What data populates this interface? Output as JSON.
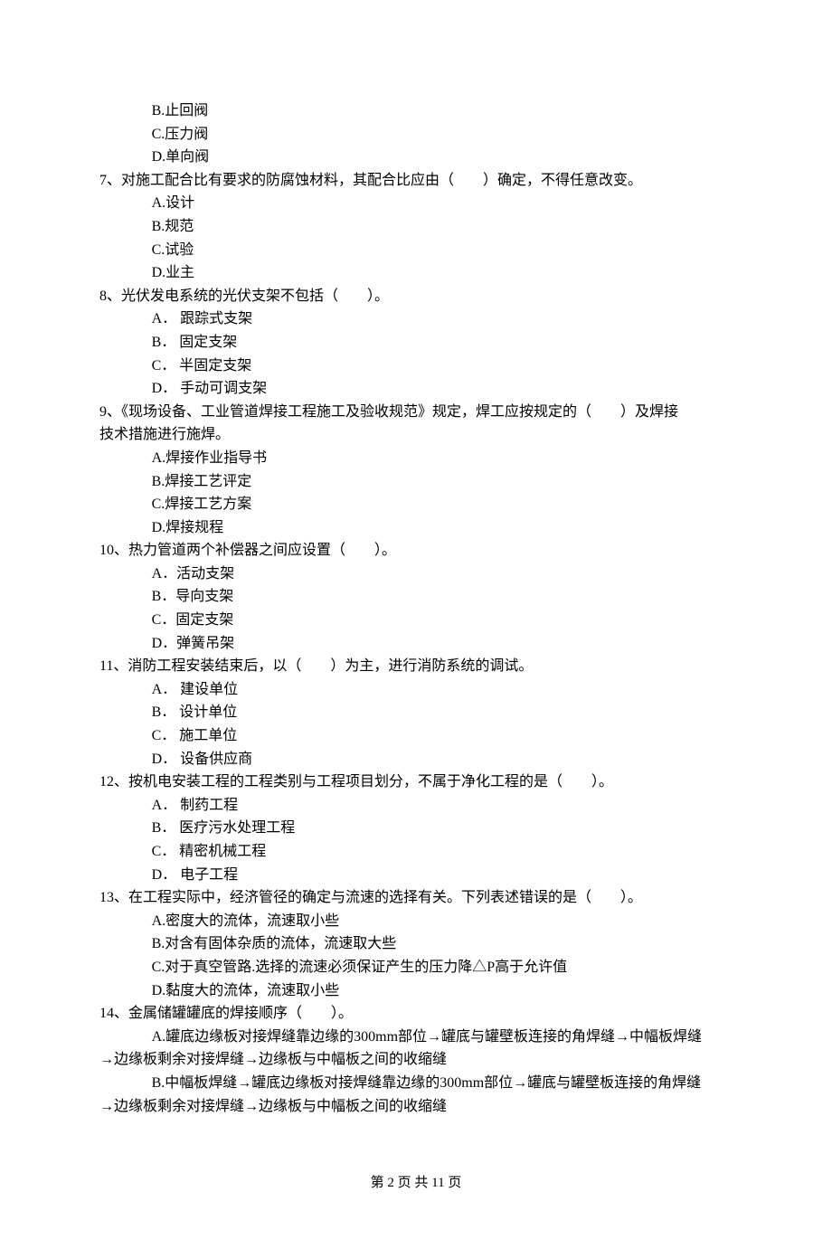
{
  "q6_options": {
    "B": "B.止回阀",
    "C": "C.压力阀",
    "D": "D.单向阀"
  },
  "q7": {
    "stem": "7、对施工配合比有要求的防腐蚀材料，其配合比应由（　　）确定，不得任意改变。",
    "A": "A.设计",
    "B": "B.规范",
    "C": "C.试验",
    "D": "D.业主"
  },
  "q8": {
    "stem": "8、光伏发电系统的光伏支架不包括（　　）。",
    "A": "A． 跟踪式支架",
    "B": "B． 固定支架",
    "C": "C． 半固定支架",
    "D": "D． 手动可调支架"
  },
  "q9": {
    "stem": "9、《现场设备、工业管道焊接工程施工及验收规范》规定，焊工应按规定的（　　）及焊接",
    "stem2": "技术措施进行施焊。",
    "A": "A.焊接作业指导书",
    "B": "B.焊接工艺评定",
    "C": "C.焊接工艺方案",
    "D": "D.焊接规程"
  },
  "q10": {
    "stem": "10、热力管道两个补偿器之间应设置（　　）。",
    "A": "A．活动支架",
    "B": "B．导向支架",
    "C": "C．固定支架",
    "D": "D．弹簧吊架"
  },
  "q11": {
    "stem": "11、消防工程安装结束后，以（　　）为主，进行消防系统的调试。",
    "A": "A． 建设单位",
    "B": "B． 设计单位",
    "C": "C． 施工单位",
    "D": "D． 设备供应商"
  },
  "q12": {
    "stem": "12、按机电安装工程的工程类别与工程项目划分，不属于净化工程的是（　　）。",
    "A": "A． 制药工程",
    "B": "B． 医疗污水处理工程",
    "C": "C． 精密机械工程",
    "D": "D． 电子工程"
  },
  "q13": {
    "stem": "13、在工程实际中，经济管径的确定与流速的选择有关。下列表述错误的是（　　）。",
    "A": "A.密度大的流体，流速取小些",
    "B": "B.对含有固体杂质的流体，流速取大些",
    "C": "C.对于真空管路.选择的流速必须保证产生的压力降△P高于允许值",
    "D": "D.黏度大的流体，流速取小些"
  },
  "q14": {
    "stem": "14、金属储罐罐底的焊接顺序（　　）。",
    "A1": "A.罐底边缘板对接焊缝靠边缘的300mm部位→罐底与罐壁板连接的角焊缝→中幅板焊缝",
    "A2": "→边缘板剩余对接焊缝→边缘板与中幅板之间的收缩缝",
    "B1": "B.中幅板焊缝→罐底边缘板对接焊缝靠边缘的300mm部位→罐底与罐壁板连接的角焊缝",
    "B2": "→边缘板剩余对接焊缝→边缘板与中幅板之间的收缩缝"
  },
  "footer": "第 2 页 共 11 页"
}
